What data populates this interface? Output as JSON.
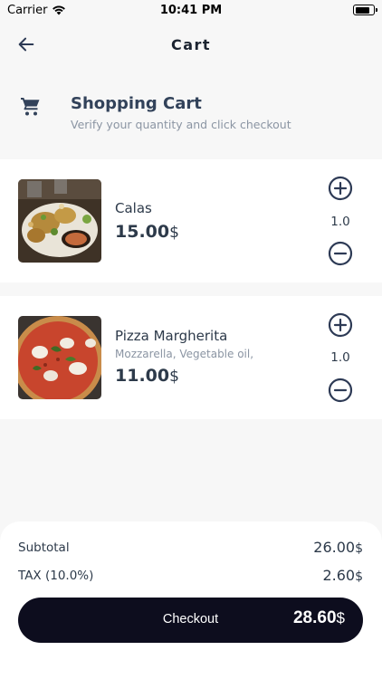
{
  "status_bar": {
    "carrier": "Carrier",
    "time": "10:41 PM",
    "battery_level": 0.8
  },
  "nav": {
    "title": "Cart",
    "back_icon": "arrow-left-icon"
  },
  "header": {
    "icon": "shopping-cart-icon",
    "title": "Shopping Cart",
    "subtitle": "Verify your quantity and click checkout"
  },
  "items": [
    {
      "name": "Calas",
      "description": "",
      "price": "15.00",
      "currency": "$",
      "quantity": "1.0",
      "image": "food-plate-photo"
    },
    {
      "name": "Pizza Margherita",
      "description": "Mozzarella, Vegetable oil,",
      "price": "11.00",
      "currency": "$",
      "quantity": "1.0",
      "image": "pizza-photo"
    }
  ],
  "summary": {
    "subtotal_label": "Subtotal",
    "subtotal_value": "26.00",
    "tax_label": "TAX (10.0%)",
    "tax_value": "2.60",
    "currency": "$"
  },
  "checkout": {
    "label": "Checkout",
    "total": "28.60",
    "currency": "$"
  },
  "colors": {
    "background": "#f7f7f7",
    "card": "#ffffff",
    "text": "#2d3a4a",
    "muted": "#8b95a3",
    "checkout_button": "#0d0d1e"
  }
}
